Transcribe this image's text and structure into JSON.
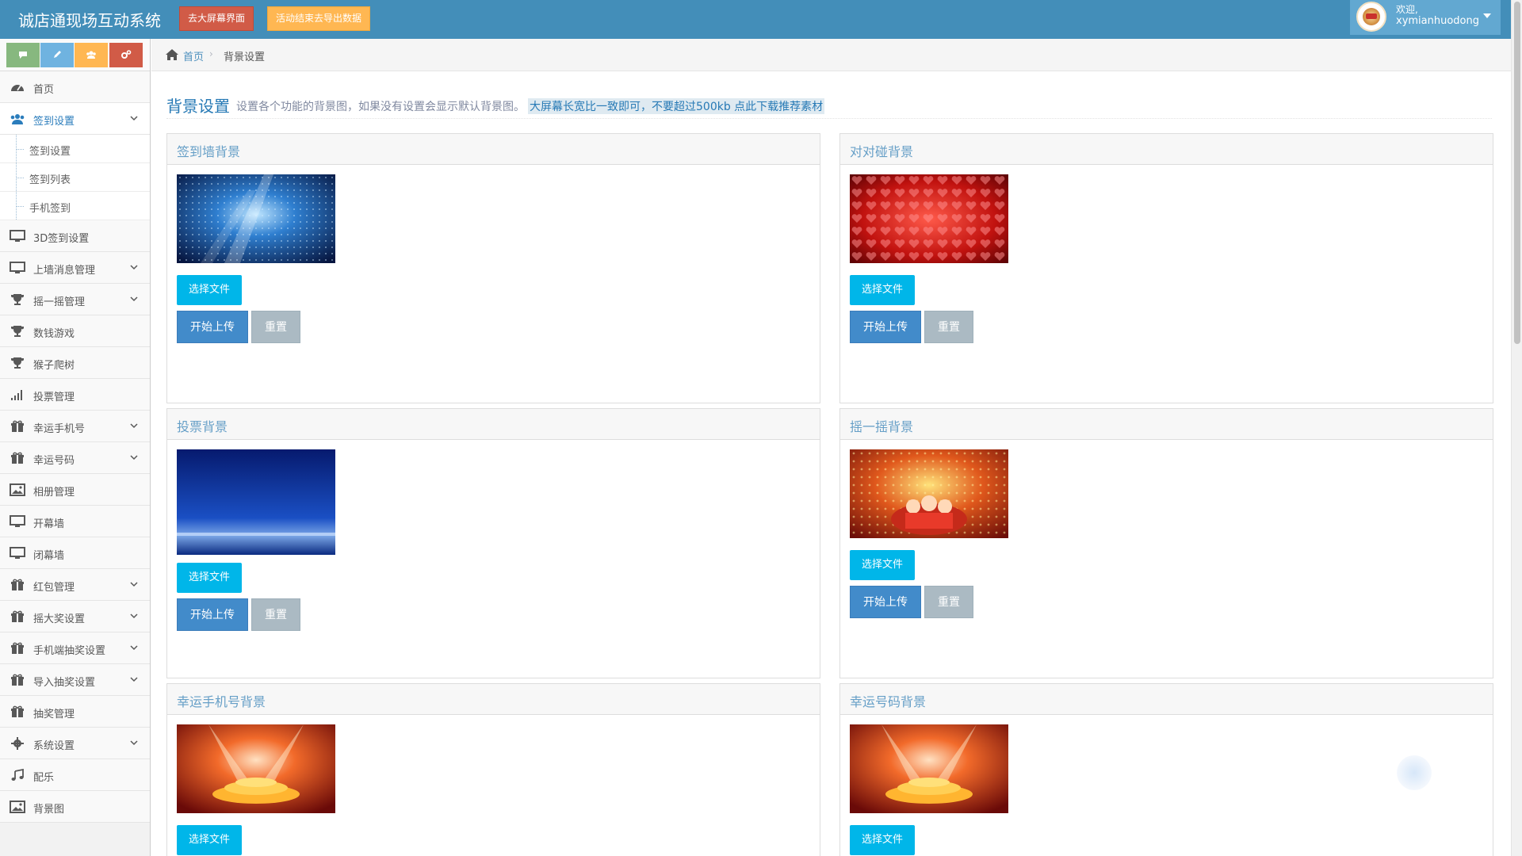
{
  "app": {
    "title": "诚店通现场互动系统"
  },
  "navbar": {
    "btn_bigscreen": "去大屏幕界面",
    "btn_export": "活动结束去导出数据",
    "user": {
      "welcome": "欢迎,",
      "name": "xymianhuodong"
    }
  },
  "sidebar": {
    "shortcuts": [
      "comment-icon",
      "pencil-icon",
      "group-icon",
      "cogs-icon"
    ],
    "items": [
      {
        "label": "首页",
        "icon": "dashboard-icon"
      },
      {
        "label": "签到设置",
        "icon": "users-icon",
        "expanded": true
      },
      {
        "label": "签到设置"
      },
      {
        "label": "签到列表"
      },
      {
        "label": "手机签到"
      },
      {
        "label": "3D签到设置",
        "icon": "desktop-icon"
      },
      {
        "label": "上墙消息管理",
        "icon": "desktop-icon"
      },
      {
        "label": "摇一摇管理",
        "icon": "trophy-icon"
      },
      {
        "label": "数钱游戏",
        "icon": "trophy-icon"
      },
      {
        "label": "猴子爬树",
        "icon": "trophy-icon"
      },
      {
        "label": "投票管理",
        "icon": "signal-icon"
      },
      {
        "label": "幸运手机号",
        "icon": "gift-icon"
      },
      {
        "label": "幸运号码",
        "icon": "gift-icon"
      },
      {
        "label": "相册管理",
        "icon": "picture-icon"
      },
      {
        "label": "开幕墙",
        "icon": "desktop-icon"
      },
      {
        "label": "闭幕墙",
        "icon": "desktop-icon"
      },
      {
        "label": "红包管理",
        "icon": "gift-icon"
      },
      {
        "label": "摇大奖设置",
        "icon": "gift-icon"
      },
      {
        "label": "手机端抽奖设置",
        "icon": "gift-icon"
      },
      {
        "label": "导入抽奖设置",
        "icon": "gift-icon"
      },
      {
        "label": "抽奖管理",
        "icon": "gift-icon"
      },
      {
        "label": "系统设置",
        "icon": "cog-icon"
      },
      {
        "label": "配乐",
        "icon": "music-icon"
      },
      {
        "label": "背景图",
        "icon": "picture-icon"
      }
    ]
  },
  "breadcrumbs": {
    "home": "首页",
    "sep": "›",
    "current": "背景设置"
  },
  "page": {
    "title": "背景设置",
    "description": "设置各个功能的背景图，如果没有设置会显示默认背景图。",
    "highlight": "大屏幕长宽比一致即可，不要超过500kb 点此下载推荐素材"
  },
  "panels": [
    {
      "title": "签到墙背景",
      "choose": "选择文件",
      "upload": "开始上传",
      "reset": "重置"
    },
    {
      "title": "对对碰背景",
      "choose": "选择文件",
      "upload": "开始上传",
      "reset": "重置"
    },
    {
      "title": "投票背景",
      "choose": "选择文件",
      "upload": "开始上传",
      "reset": "重置"
    },
    {
      "title": "摇一摇背景",
      "choose": "选择文件",
      "upload": "开始上传",
      "reset": "重置"
    },
    {
      "title": "幸运手机号背景",
      "choose": "选择文件"
    },
    {
      "title": "幸运号码背景",
      "choose": "选择文件"
    }
  ],
  "colors": {
    "navbar": "#438eb9",
    "accent": "#2679b5",
    "choose_btn": "#00b6e9",
    "upload_btn": "#428bca",
    "reset_btn": "#abbac3"
  }
}
